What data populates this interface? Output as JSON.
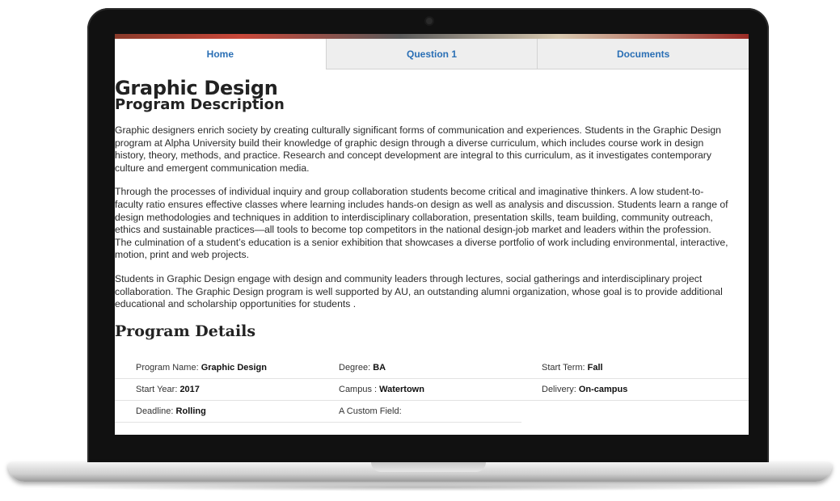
{
  "tabs": [
    {
      "label": "Home"
    },
    {
      "label": "Question 1"
    },
    {
      "label": "Documents"
    }
  ],
  "page": {
    "title": "Graphic Design",
    "subtitle": "Program Description",
    "paragraphs": [
      "Graphic designers enrich society by creating culturally significant forms of communication and experiences. Students in the Graphic Design program at Alpha University build their knowledge of graphic design through a diverse curriculum, which includes course work in design history, theory, methods, and practice. Research and concept development are integral to this curriculum, as it investigates contemporary culture and emergent communication media.",
      "Through the processes of individual inquiry and group collaboration students become critical and imaginative thinkers. A low student-to-faculty ratio ensures effective classes where learning includes hands-on design as well as analysis and discussion. Students learn a range of design methodologies and techniques in addition to interdisciplinary collaboration, presentation skills, team building, community outreach, ethics and sustainable practices—all tools to become top competitors in the national design-job market and leaders within the profession. The culmination of a student’s education is a senior exhibition that showcases a diverse portfolio of work including environmental, interactive, motion, print and web projects.",
      "Students in Graphic Design engage with design and community leaders through lectures, social gatherings and interdisciplinary project collaboration. The Graphic Design program is well supported by AU, an outstanding alumni organization, whose goal is to provide additional educational and scholarship opportunities for students ."
    ],
    "details_title": "Program Details"
  },
  "details": {
    "program_name": {
      "label": "Program Name: ",
      "value": "Graphic Design"
    },
    "degree": {
      "label": "Degree: ",
      "value": "BA"
    },
    "start_term": {
      "label": "Start Term: ",
      "value": "Fall"
    },
    "start_year": {
      "label": "Start Year: ",
      "value": "2017"
    },
    "campus": {
      "label": "Campus : ",
      "value": "Watertown"
    },
    "delivery": {
      "label": "Delivery: ",
      "value": "On-campus"
    },
    "deadline": {
      "label": "Deadline: ",
      "value": "Rolling"
    },
    "custom_field": {
      "label": "A Custom Field:",
      "value": ""
    }
  },
  "colors": {
    "tab_text": "#2a6fb5",
    "tab_inactive_bg": "#eeeeee"
  }
}
